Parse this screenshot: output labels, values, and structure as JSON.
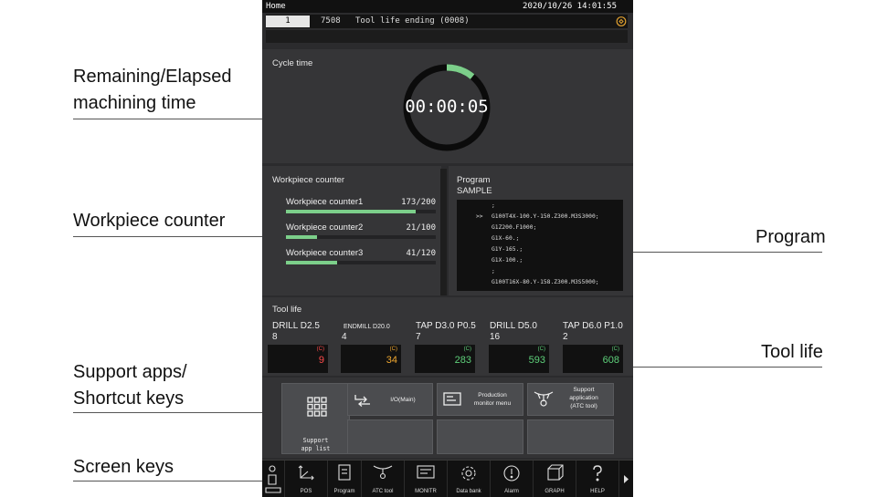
{
  "callouts": {
    "elapsed_time_line1": "Remaining/Elapsed",
    "elapsed_time_line2": "machining time",
    "workpiece_counter": "Workpiece counter",
    "support_apps_line1": "Support apps/",
    "support_apps_line2": "Shortcut keys",
    "screen_keys": "Screen keys",
    "program": "Program",
    "tool_life": "Tool life"
  },
  "status_bar": {
    "title": "Home",
    "datetime": "2020/10/26 14:01:55"
  },
  "alarm": {
    "number": "1",
    "code": "7508",
    "message": "Tool life ending (0008)"
  },
  "cycle": {
    "title": "Cycle time",
    "time": "00:00:05",
    "progress_fraction": 0.11
  },
  "workpiece": {
    "title": "Workpiece counter",
    "counters": [
      {
        "label": "Workpiece counter1",
        "value": "173/200",
        "count": 173,
        "target": 200
      },
      {
        "label": "Workpiece counter2",
        "value": "21/100",
        "count": 21,
        "target": 100
      },
      {
        "label": "Workpiece counter3",
        "value": "41/120",
        "count": 41,
        "target": 120
      }
    ]
  },
  "program": {
    "title": "Program",
    "name": "SAMPLE",
    "cursor": ">>",
    "lines": [
      ";",
      "G100T4X-100.Y-150.Z300.M3S3000;",
      "G1Z200.F1000;",
      "G1X-60.;",
      "G1Y-165.;",
      "G1X-100.;",
      ";",
      "G100T16X-80.Y-158.Z300.M3S5000;"
    ]
  },
  "tool_life": {
    "title": "Tool life",
    "tools": [
      {
        "name": "DRILL D2.5",
        "count": "8",
        "unit": "(C)",
        "value": "9",
        "color": "#ff4a4a"
      },
      {
        "name": "ENDMILL D20.0",
        "count": "4",
        "unit": "(C)",
        "value": "34",
        "color": "#f0a830"
      },
      {
        "name": "TAP D3.0 P0.5",
        "count": "7",
        "unit": "(C)",
        "value": "283",
        "color": "#5ed07a"
      },
      {
        "name": "DRILL D5.0",
        "count": "16",
        "unit": "(C)",
        "value": "593",
        "color": "#5ed07a"
      },
      {
        "name": "TAP D6.0 P1.0",
        "count": "2",
        "unit": "(C)",
        "value": "608",
        "color": "#5ed07a"
      }
    ]
  },
  "apps": {
    "support_app_list_line1": "Support",
    "support_app_list_line2": "app list",
    "io_main": "I/O(Main)",
    "production_line1": "Production",
    "production_line2": "monitor menu",
    "atc_line1": "Support",
    "atc_line2": "application",
    "atc_line3": "(ATC tool)"
  },
  "screen_keys": {
    "pos": "POS",
    "program": "Program",
    "atc_tool": "ATC tool",
    "monitor": "MONITR",
    "data_bank": "Data bank",
    "alarm": "Alarm",
    "graph": "GRAPH",
    "help": "HELP"
  },
  "colors": {
    "accent_green": "#7ccf8a",
    "alarm_icon": "#e0a030"
  }
}
